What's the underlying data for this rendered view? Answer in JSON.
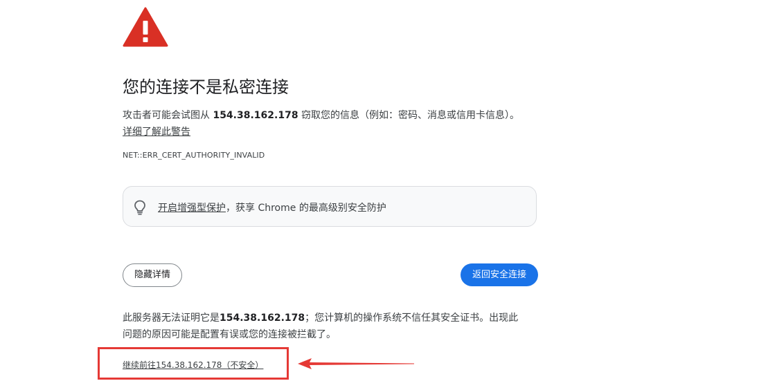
{
  "heading": "您的连接不是私密连接",
  "description": {
    "prefix": "攻击者可能会试图从 ",
    "host": "154.38.162.178",
    "suffix": " 窃取您的信息（例如：密码、消息或信用卡信息）。",
    "learn_more": "详细了解此警告"
  },
  "error_code": "NET::ERR_CERT_AUTHORITY_INVALID",
  "promo": {
    "icon": "lightbulb-icon",
    "link": "开启增强型保护",
    "suffix": "，获享 Chrome 的最高级别安全防护"
  },
  "buttons": {
    "hide_details": "隐藏详情",
    "back_to_safety": "返回安全连接"
  },
  "details": {
    "prefix": "此服务器无法证明它是",
    "host": "154.38.162.178",
    "line1_suffix": "；您计算机的操作系统不信任其安全证书。出现此",
    "line2": "问题的原因可能是配置有误或您的连接被拦截了。"
  },
  "proceed_link": "继续前往154.38.162.178（不安全）",
  "colors": {
    "warning_red": "#d93025",
    "primary_blue": "#1a73e8",
    "annotation_red": "#e53935"
  }
}
